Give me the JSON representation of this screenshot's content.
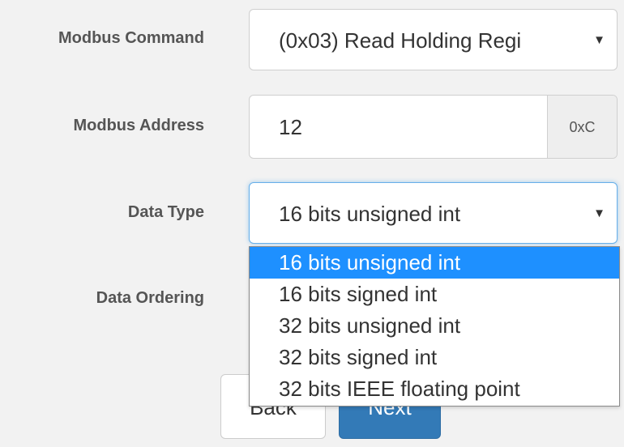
{
  "form": {
    "modbus_command": {
      "label": "Modbus Command",
      "value": "(0x03) Read Holding Regi"
    },
    "modbus_address": {
      "label": "Modbus Address",
      "value": "12",
      "hex_addon": "0xC"
    },
    "data_type": {
      "label": "Data Type",
      "value": "16 bits unsigned int",
      "options": [
        "16 bits unsigned int",
        "16 bits signed int",
        "32 bits unsigned int",
        "32 bits signed int",
        "32 bits IEEE floating point"
      ],
      "highlighted_index": 0
    },
    "data_ordering": {
      "label": "Data Ordering"
    }
  },
  "buttons": {
    "back_label": "Back",
    "next_label": "Next"
  },
  "icons": {
    "select_arrow": "caret-down-icon"
  },
  "colors": {
    "highlight": "#1e90ff",
    "primary_button": "#337ab7",
    "focus_border": "#66afe9"
  }
}
